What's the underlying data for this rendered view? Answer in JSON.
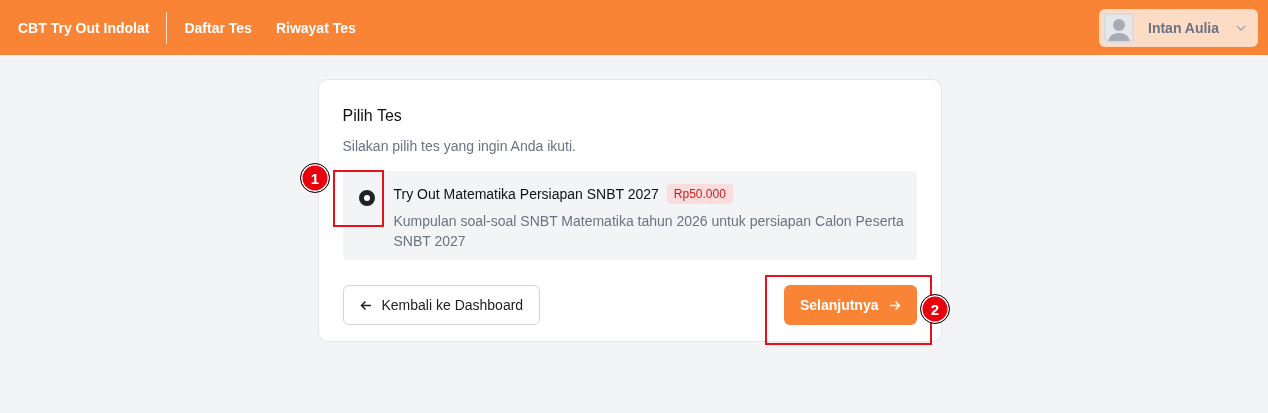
{
  "navbar": {
    "brand": "CBT Try Out Indolat",
    "links": [
      {
        "label": "Daftar Tes"
      },
      {
        "label": "Riwayat Tes"
      }
    ],
    "user": {
      "name": "Intan Aulia"
    }
  },
  "card": {
    "title": "Pilih Tes",
    "subtitle": "Silakan pilih tes yang ingin Anda ikuti.",
    "options": [
      {
        "title": "Try Out Matematika Persiapan SNBT 2027",
        "price": "Rp50.000",
        "description": "Kumpulan soal-soal SNBT Matematika tahun 2026 untuk persiapan Calon Peserta SNBT 2027",
        "selected": true
      }
    ],
    "back_button": "Kembali ke Dashboard",
    "next_button": "Selanjutnya"
  },
  "annotations": [
    {
      "label": "1"
    },
    {
      "label": "2"
    }
  ]
}
